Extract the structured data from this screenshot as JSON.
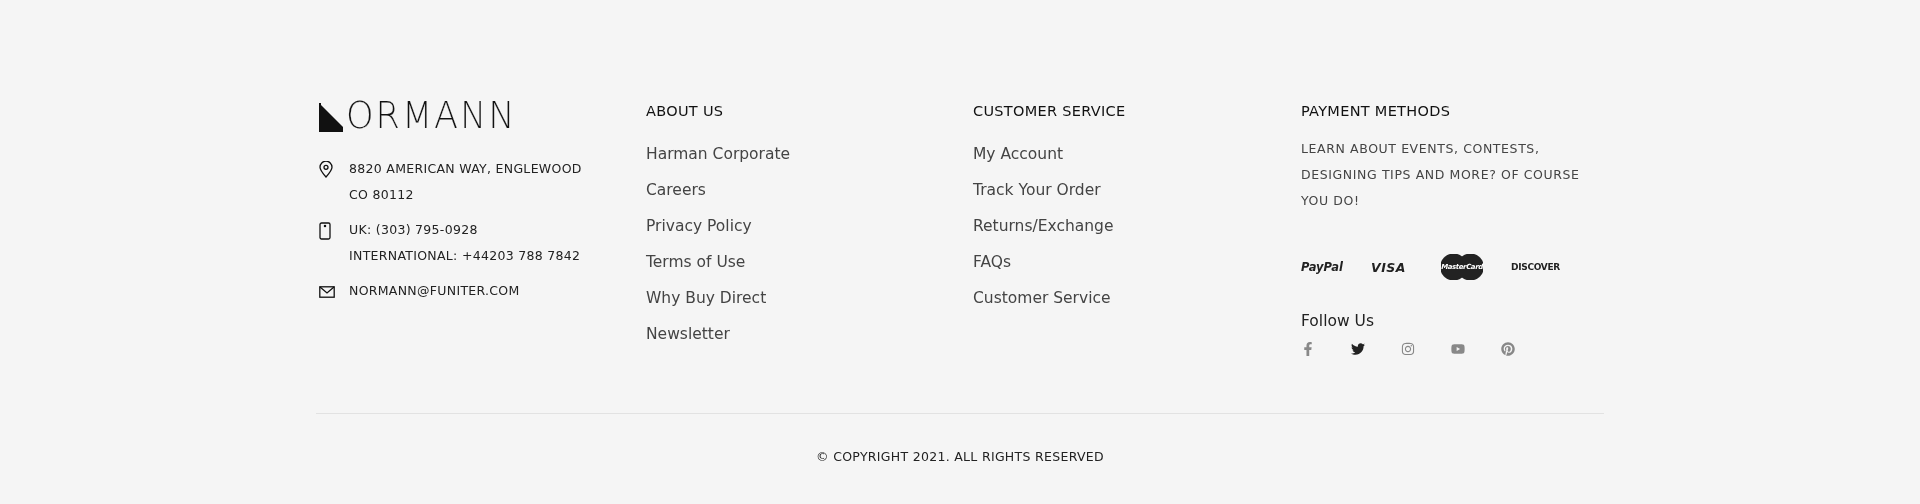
{
  "logo": {
    "text": "ORMANN"
  },
  "contact": [
    {
      "kind": "location",
      "lines": [
        "8820 AMERICAN WAY, ENGLEWOOD",
        "CO 80112"
      ]
    },
    {
      "kind": "phone",
      "lines": [
        "UK: (303) 795-0928",
        "INTERNATIONAL: +44203 788 7842"
      ]
    },
    {
      "kind": "mail",
      "lines": [
        "NORMANN@FUNITER.COM"
      ]
    }
  ],
  "columns": [
    {
      "title": "ABOUT US",
      "links": [
        "Harman Corporate",
        "Careers",
        "Privacy Policy",
        "Terms of Use",
        "Why Buy Direct",
        "Newsletter"
      ]
    },
    {
      "title": "CUSTOMER SERVICE",
      "links": [
        "My Account",
        "Track Your Order",
        "Returns/Exchange",
        "FAQs",
        "Customer Service"
      ]
    }
  ],
  "payment": {
    "title": "PAYMENT METHODS",
    "text": "LEARN ABOUT EVENTS, CONTESTS, DESIGNING TIPS AND MORE? OF COURSE YOU DO!",
    "methods": [
      {
        "kind": "paypal",
        "label": "PayPal"
      },
      {
        "kind": "visa",
        "label": "VISA"
      },
      {
        "kind": "mastercard",
        "label": "MasterCard"
      },
      {
        "kind": "discover",
        "label": "DISCOVER"
      }
    ]
  },
  "follow": {
    "title": "Follow Us",
    "socials": [
      {
        "kind": "facebook",
        "active": false
      },
      {
        "kind": "twitter",
        "active": true
      },
      {
        "kind": "instagram",
        "active": false
      },
      {
        "kind": "youtube",
        "active": false
      },
      {
        "kind": "pinterest",
        "active": false
      }
    ]
  },
  "copyright": "© COPYRIGHT 2021. ALL RIGHTS RESERVED"
}
